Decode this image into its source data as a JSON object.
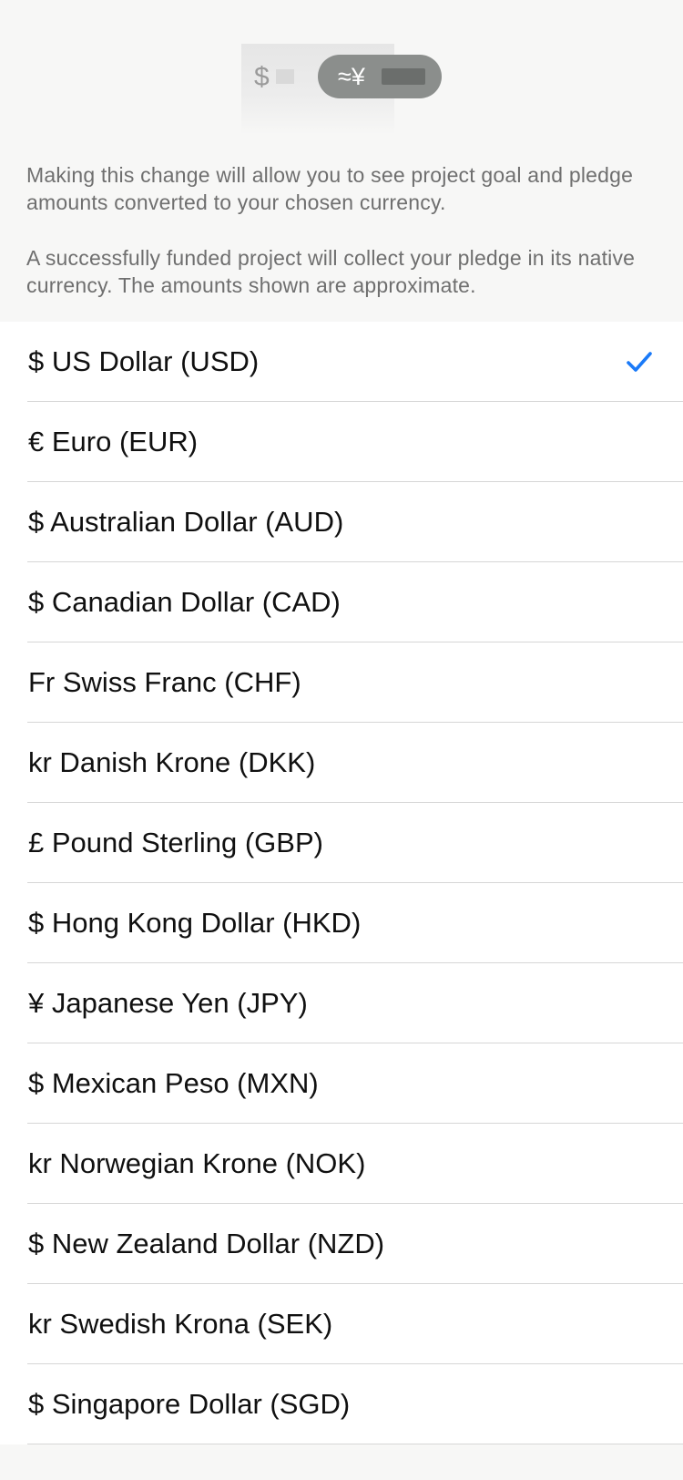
{
  "illustration": {
    "card_symbol": "$",
    "pill_symbol": "≈¥"
  },
  "info": {
    "paragraph_1": "Making this change will allow you to see project goal and pledge amounts converted to your chosen currency.",
    "paragraph_2": "A successfully funded project will collect your pledge in its native currency. The amounts shown are approximate."
  },
  "currencies": [
    {
      "label": "$ US Dollar (USD)",
      "selected": true
    },
    {
      "label": "€ Euro (EUR)",
      "selected": false
    },
    {
      "label": "$ Australian Dollar (AUD)",
      "selected": false
    },
    {
      "label": "$ Canadian Dollar (CAD)",
      "selected": false
    },
    {
      "label": "Fr Swiss Franc (CHF)",
      "selected": false
    },
    {
      "label": "kr Danish Krone (DKK)",
      "selected": false
    },
    {
      "label": "£ Pound Sterling (GBP)",
      "selected": false
    },
    {
      "label": "$ Hong Kong Dollar (HKD)",
      "selected": false
    },
    {
      "label": "¥ Japanese Yen (JPY)",
      "selected": false
    },
    {
      "label": "$ Mexican Peso (MXN)",
      "selected": false
    },
    {
      "label": "kr Norwegian Krone (NOK)",
      "selected": false
    },
    {
      "label": "$ New Zealand Dollar (NZD)",
      "selected": false
    },
    {
      "label": "kr Swedish Krona (SEK)",
      "selected": false
    },
    {
      "label": "$ Singapore Dollar (SGD)",
      "selected": false
    }
  ],
  "colors": {
    "accent": "#1a7af8",
    "background": "#f7f7f6",
    "secondary_text": "#6f6f6f"
  },
  "icons": {
    "selected_indicator": "checkmark-icon"
  }
}
